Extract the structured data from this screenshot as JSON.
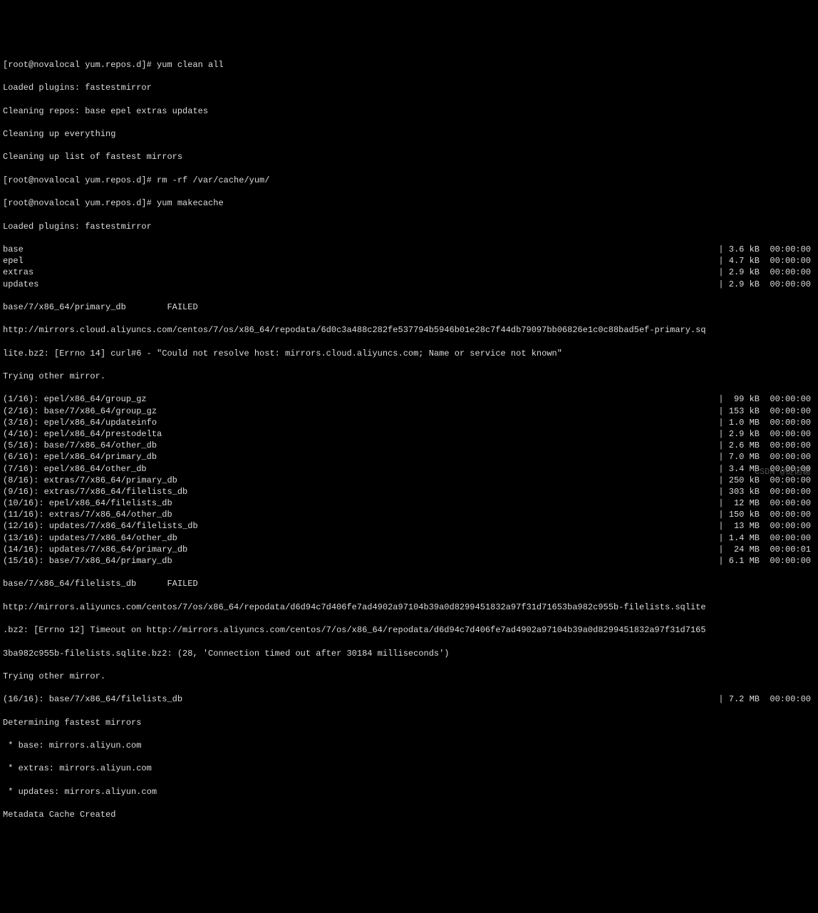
{
  "prompt1": "[root@novalocal yum.repos.d]# yum clean all",
  "l1": "Loaded plugins: fastestmirror",
  "l2": "Cleaning repos: base epel extras updates",
  "l3": "Cleaning up everything",
  "l4": "Cleaning up list of fastest mirrors",
  "prompt2": "[root@novalocal yum.repos.d]# rm -rf /var/cache/yum/",
  "prompt3": "[root@novalocal yum.repos.d]# yum makecache",
  "l5": "Loaded plugins: fastestmirror",
  "repos": [
    {
      "name": "base",
      "size": "| 3.6 kB  00:00:00"
    },
    {
      "name": "epel",
      "size": "| 4.7 kB  00:00:00"
    },
    {
      "name": "extras",
      "size": "| 2.9 kB  00:00:00"
    },
    {
      "name": "updates",
      "size": "| 2.9 kB  00:00:00"
    }
  ],
  "fail1": "base/7/x86_64/primary_db        FAILED",
  "fail1url": "http://mirrors.cloud.aliyuncs.com/centos/7/os/x86_64/repodata/6d0c3a488c282fe537794b5946b01e28c7f44db79097bb06826e1c0c88bad5ef-primary.sq",
  "fail1err": "lite.bz2: [Errno 14] curl#6 - \"Could not resolve host: mirrors.cloud.aliyuncs.com; Name or service not known\"",
  "try1": "Trying other mirror.",
  "downloads": [
    {
      "left": "(1/16): epel/x86_64/group_gz",
      "right": "|  99 kB  00:00:00"
    },
    {
      "left": "(2/16): base/7/x86_64/group_gz",
      "right": "| 153 kB  00:00:00"
    },
    {
      "left": "(3/16): epel/x86_64/updateinfo",
      "right": "| 1.0 MB  00:00:00"
    },
    {
      "left": "(4/16): epel/x86_64/prestodelta",
      "right": "| 2.9 kB  00:00:00"
    },
    {
      "left": "(5/16): base/7/x86_64/other_db",
      "right": "| 2.6 MB  00:00:00"
    },
    {
      "left": "(6/16): epel/x86_64/primary_db",
      "right": "| 7.0 MB  00:00:00"
    },
    {
      "left": "(7/16): epel/x86_64/other_db",
      "right": "| 3.4 MB  00:00:00"
    },
    {
      "left": "(8/16): extras/7/x86_64/primary_db",
      "right": "| 250 kB  00:00:00"
    },
    {
      "left": "(9/16): extras/7/x86_64/filelists_db",
      "right": "| 303 kB  00:00:00"
    },
    {
      "left": "(10/16): epel/x86_64/filelists_db",
      "right": "|  12 MB  00:00:00"
    },
    {
      "left": "(11/16): extras/7/x86_64/other_db",
      "right": "| 150 kB  00:00:00"
    },
    {
      "left": "(12/16): updates/7/x86_64/filelists_db",
      "right": "|  13 MB  00:00:00"
    },
    {
      "left": "(13/16): updates/7/x86_64/other_db",
      "right": "| 1.4 MB  00:00:00"
    },
    {
      "left": "(14/16): updates/7/x86_64/primary_db",
      "right": "|  24 MB  00:00:01"
    },
    {
      "left": "(15/16): base/7/x86_64/primary_db",
      "right": "| 6.1 MB  00:00:00"
    }
  ],
  "fail2": "base/7/x86_64/filelists_db      FAILED",
  "fail2a": "http://mirrors.aliyuncs.com/centos/7/os/x86_64/repodata/d6d94c7d406fe7ad4902a97104b39a0d8299451832a97f31d71653ba982c955b-filelists.sqlite",
  "fail2b": ".bz2: [Errno 12] Timeout on http://mirrors.aliyuncs.com/centos/7/os/x86_64/repodata/d6d94c7d406fe7ad4902a97104b39a0d8299451832a97f31d7165",
  "fail2c": "3ba982c955b-filelists.sqlite.bz2: (28, 'Connection timed out after 30184 milliseconds')",
  "try2": "Trying other mirror.",
  "d16": {
    "left": "(16/16): base/7/x86_64/filelists_db",
    "right": "| 7.2 MB  00:00:00"
  },
  "det": "Determining fastest mirrors",
  "m1": " * base: mirrors.aliyun.com",
  "m2": " * extras: mirrors.aliyun.com",
  "m3": " * updates: mirrors.aliyun.com",
  "done": "Metadata Cache Created",
  "watermark": "CSDN @链诺葛"
}
